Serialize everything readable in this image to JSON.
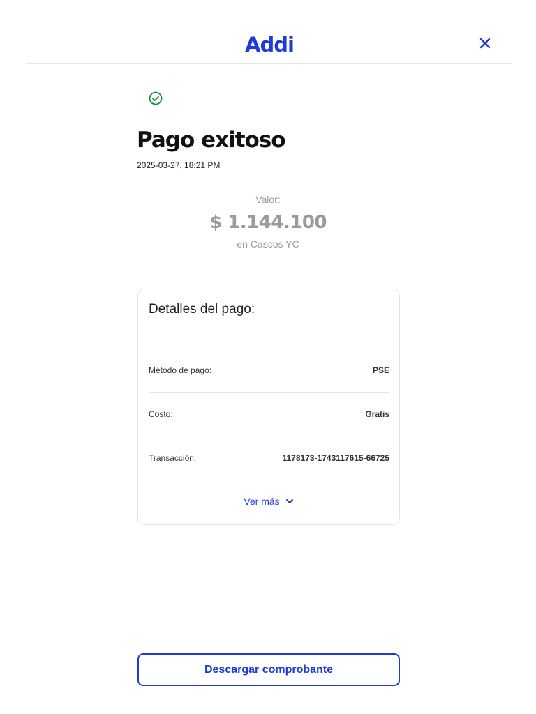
{
  "header": {
    "logo": "Addi",
    "logo_color": "#1e3ad8",
    "close_icon": "close-icon"
  },
  "status": {
    "icon": "check-circle-icon",
    "icon_color": "#1a8a3a",
    "title": "Pago exitoso",
    "datetime": "2025-03-27, 18:21 PM"
  },
  "amount": {
    "label": "Valor:",
    "value": "$ 1.144.100",
    "merchant": "en Cascos YC"
  },
  "details": {
    "title": "Detalles del pago:",
    "rows": [
      {
        "label": "Método de pago:",
        "value": "PSE"
      },
      {
        "label": "Costo:",
        "value": "Gratis"
      },
      {
        "label": "Transacción:",
        "value": "1178173-1743117615-66725"
      }
    ],
    "more_label": "Ver más",
    "more_icon": "chevron-down-icon"
  },
  "actions": {
    "download_label": "Descargar comprobante"
  },
  "colors": {
    "accent": "#1e3ad8",
    "muted": "#9a9a9a",
    "border": "#e4e4e4"
  }
}
